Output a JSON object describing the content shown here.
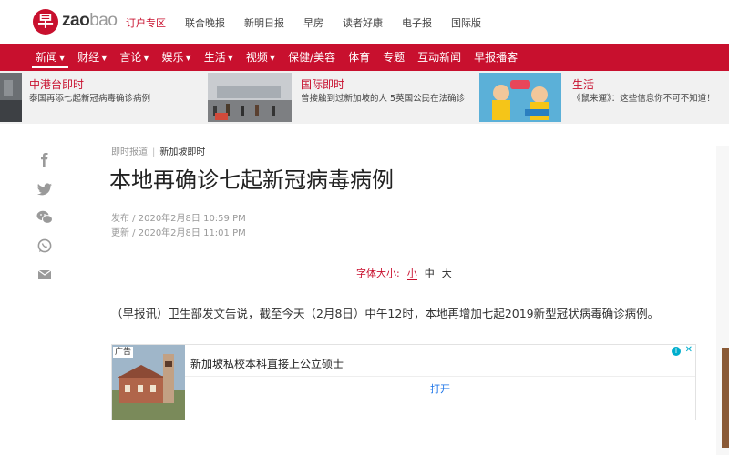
{
  "header": {
    "logo_glyph": "早",
    "logo_zao": "zao",
    "logo_bao": "bao",
    "links": [
      {
        "label": "订户专区",
        "highlight": true
      },
      {
        "label": "联合晚报",
        "highlight": false
      },
      {
        "label": "新明日报",
        "highlight": false
      },
      {
        "label": "早房",
        "highlight": false
      },
      {
        "label": "读者好康",
        "highlight": false
      },
      {
        "label": "电子报",
        "highlight": false
      },
      {
        "label": "国际版",
        "highlight": false
      }
    ]
  },
  "nav": {
    "items": [
      {
        "label": "新闻",
        "dropdown": true,
        "active": true
      },
      {
        "label": "财经",
        "dropdown": true,
        "active": false
      },
      {
        "label": "言论",
        "dropdown": true,
        "active": false
      },
      {
        "label": "娱乐",
        "dropdown": true,
        "active": false
      },
      {
        "label": "生活",
        "dropdown": true,
        "active": false
      },
      {
        "label": "视频",
        "dropdown": true,
        "active": false
      },
      {
        "label": "保健/美容",
        "dropdown": false,
        "active": false
      },
      {
        "label": "体育",
        "dropdown": false,
        "active": false
      },
      {
        "label": "专题",
        "dropdown": false,
        "active": false
      },
      {
        "label": "互动新闻",
        "dropdown": false,
        "active": false
      },
      {
        "label": "早报播客",
        "dropdown": false,
        "active": false
      }
    ]
  },
  "teasers": [
    {
      "title": "中港台即时",
      "desc": "泰国再添七起新冠病毒确诊病例"
    },
    {
      "title": "国际即时",
      "desc": "曾接触到过新加坡的人 5英国公民在法确诊"
    },
    {
      "title": "生活",
      "desc": "《鼠来運》：这些信息你不可不知道！"
    }
  ],
  "social_icons": [
    "facebook-icon",
    "twitter-icon",
    "wechat-icon",
    "whatsapp-icon",
    "email-icon"
  ],
  "article": {
    "breadcrumb_section": "即时报道",
    "breadcrumb_separator": "|",
    "breadcrumb_category": "新加坡即时",
    "headline": "本地再确诊七起新冠病毒病例",
    "published": "发布 / 2020年2月8日 10:59 PM",
    "updated": "更新 / 2020年2月8日 11:01 PM",
    "font_size_label": "字体大小:",
    "font_sizes": [
      "小",
      "中",
      "大"
    ],
    "font_size_selected": "小",
    "body": "（早报讯）卫生部发文告说，截至今天（2月8日）中午12时，本地再增加七起2019新型冠状病毒确诊病例。"
  },
  "ad": {
    "label": "广告",
    "title": "新加坡私校本科直接上公立硕士",
    "info_glyph": "i",
    "close_glyph": "✕",
    "cta": "打开"
  },
  "colors": {
    "brand_red": "#c8102e",
    "ad_accent": "#00aecd",
    "link_blue": "#1a73e8"
  }
}
